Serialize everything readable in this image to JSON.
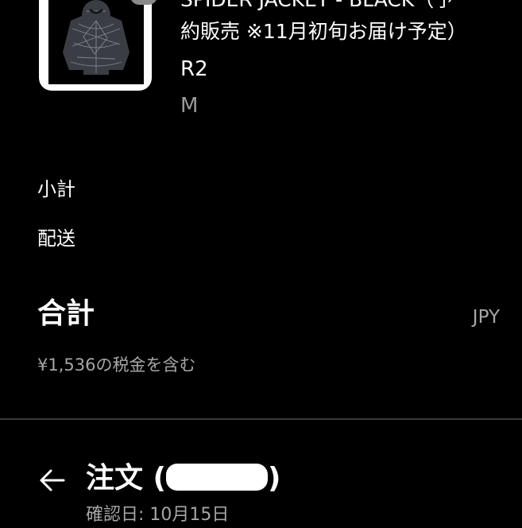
{
  "product": {
    "title_line1": "SPIDER JACKET - BLACK（予",
    "title_line2": "約販売 ※11月初旬お届け予定）",
    "variant": "R2",
    "size": "M",
    "thumbnail_icon": "jacket-image"
  },
  "summary": {
    "subtotal_label": "小計",
    "shipping_label": "配送",
    "total_label": "合計",
    "currency": "JPY",
    "tax_note": "¥1,536の税金を含む"
  },
  "order": {
    "back_icon": "arrow-left-icon",
    "title_prefix": "注文 (",
    "title_suffix": ")",
    "confirmed_date": "確認日: 10月15日"
  },
  "colors": {
    "background": "#000000",
    "text_primary": "#ffffff",
    "text_secondary": "#a6a6a6",
    "divider": "#3a3a3a"
  }
}
